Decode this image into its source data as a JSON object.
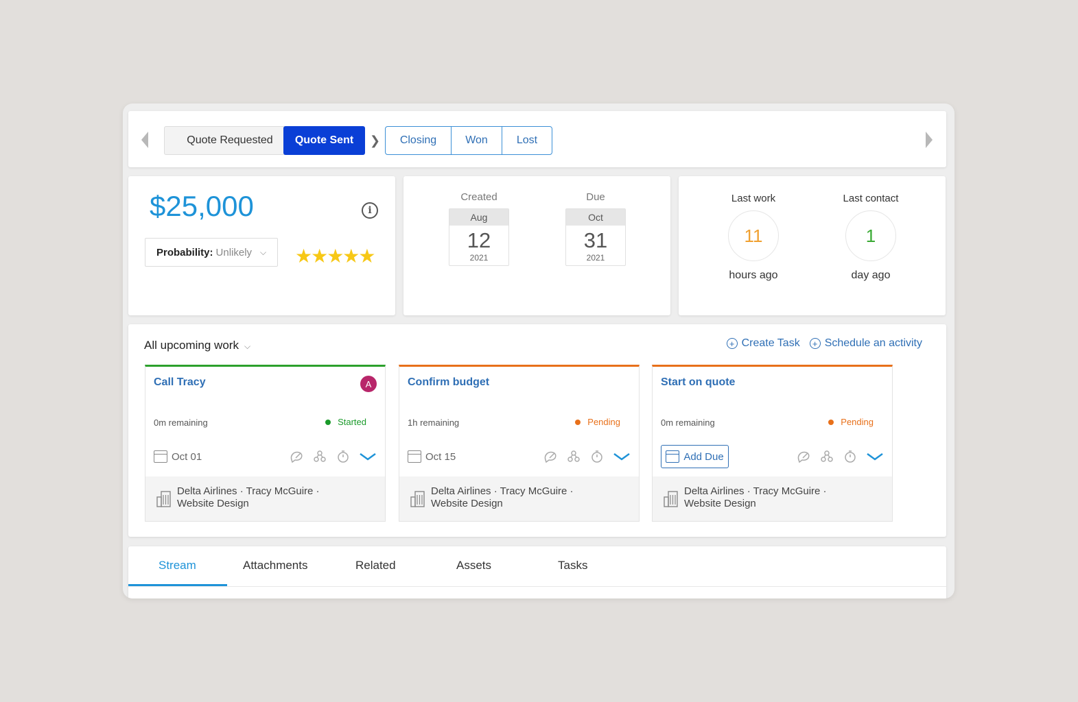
{
  "stages": {
    "current": [
      "Quote Requested",
      "Quote Sent"
    ],
    "remaining": [
      "Closing",
      "Won",
      "Lost"
    ]
  },
  "deal": {
    "amount": "$25,000",
    "probability_label": "Probability:",
    "probability_value": "Unlikely",
    "rating": 5,
    "stars": "★★★★★"
  },
  "dates": {
    "created": {
      "label": "Created",
      "month": "Aug",
      "day": "12",
      "year": "2021"
    },
    "due": {
      "label": "Due",
      "month": "Oct",
      "day": "31",
      "year": "2021"
    }
  },
  "recency": {
    "last_work": {
      "label": "Last work",
      "value": "11",
      "unit": "hours ago",
      "color": "#f0a030"
    },
    "last_contact": {
      "label": "Last contact",
      "value": "1",
      "unit": "day ago",
      "color": "#3aaa35"
    }
  },
  "upcoming": {
    "title": "All upcoming work",
    "create_task": "Create Task",
    "schedule": "Schedule an activity",
    "tasks": [
      {
        "name": "Call Tracy",
        "avatar": "A",
        "remaining": "0m remaining",
        "status": "Started",
        "status_color": "#1a9a2a",
        "border_color": "#2ca02c",
        "due": "Oct 01",
        "context_line1": "Delta Airlines · Tracy McGuire ·",
        "context_line2": "Website Design"
      },
      {
        "name": "Confirm budget",
        "remaining": "1h remaining",
        "status": "Pending",
        "status_color": "#e8701a",
        "border_color": "#e8701a",
        "due": "Oct 15",
        "context_line1": "Delta Airlines · Tracy McGuire ·",
        "context_line2": "Website Design"
      },
      {
        "name": "Start on quote",
        "remaining": "0m remaining",
        "status": "Pending",
        "status_color": "#e8701a",
        "border_color": "#e8701a",
        "add_due": "Add Due",
        "context_line1": "Delta Airlines · Tracy McGuire ·",
        "context_line2": "Website Design"
      }
    ]
  },
  "tabs": [
    "Stream",
    "Attachments",
    "Related",
    "Assets",
    "Tasks"
  ],
  "active_tab": "Stream"
}
